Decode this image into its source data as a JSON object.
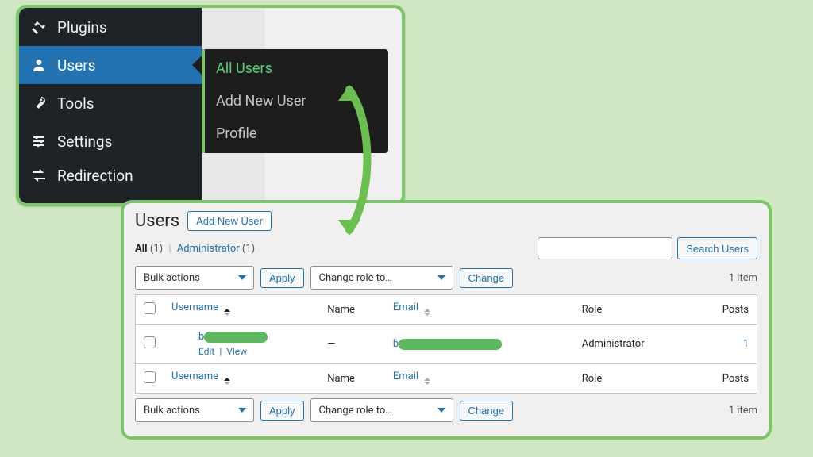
{
  "menu": {
    "items": [
      {
        "label": "Plugins",
        "icon": "plugin-icon"
      },
      {
        "label": "Users",
        "icon": "user-icon"
      },
      {
        "label": "Tools",
        "icon": "wrench-icon"
      },
      {
        "label": "Settings",
        "icon": "sliders-icon"
      },
      {
        "label": "Redirection",
        "icon": "redirect-icon"
      }
    ],
    "active_index": 1,
    "submenu": {
      "items": [
        {
          "label": "All Users",
          "current": true
        },
        {
          "label": "Add New User",
          "current": false
        },
        {
          "label": "Profile",
          "current": false
        }
      ]
    }
  },
  "users_page": {
    "title": "Users",
    "add_new_label": "Add New User",
    "filters": {
      "all_label": "All",
      "all_count": "(1)",
      "admin_label": "Administrator",
      "admin_count": "(1)"
    },
    "search": {
      "placeholder": "",
      "button_label": "Search Users"
    },
    "bulk": {
      "bulk_actions_label": "Bulk actions",
      "apply_label": "Apply",
      "change_role_label": "Change role to…",
      "change_label": "Change"
    },
    "pagination": {
      "text": "1 item"
    },
    "columns": {
      "username": "Username",
      "name": "Name",
      "email": "Email",
      "role": "Role",
      "posts": "Posts"
    },
    "row": {
      "username_initial": "b",
      "name": "—",
      "email_initial": "b",
      "role": "Administrator",
      "posts": "1",
      "actions": {
        "edit": "Edit",
        "view": "View"
      }
    }
  }
}
